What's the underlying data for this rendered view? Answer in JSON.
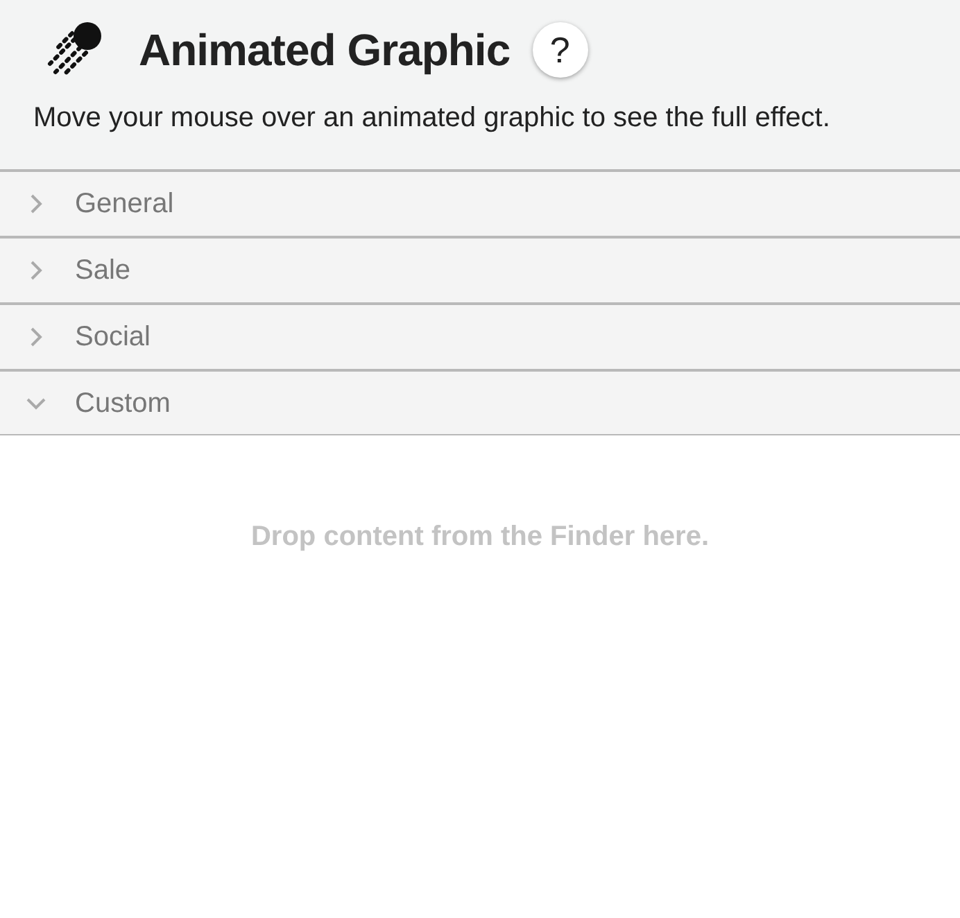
{
  "header": {
    "title": "Animated Graphic",
    "help": "?",
    "description": "Move your mouse over an animated graphic to see the full effect."
  },
  "sections": [
    {
      "label": "General",
      "expanded": false
    },
    {
      "label": "Sale",
      "expanded": false
    },
    {
      "label": "Social",
      "expanded": false
    },
    {
      "label": "Custom",
      "expanded": true
    }
  ],
  "drop_zone": {
    "text": "Drop content from the Finder here."
  }
}
